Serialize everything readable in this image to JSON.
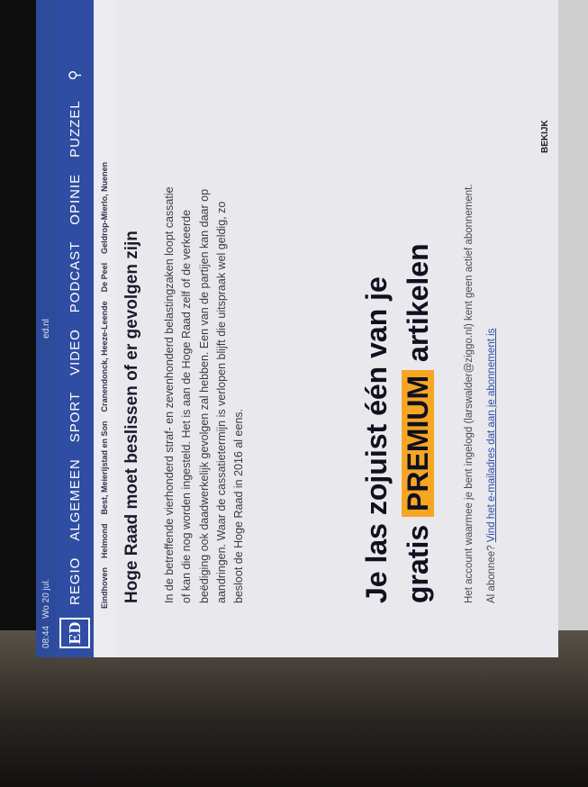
{
  "status": {
    "time": "08:44",
    "date": "Wo 20 jul.",
    "url": "ed.nl"
  },
  "nav": {
    "logo": "ED",
    "items": [
      "REGIO",
      "ALGEMEEN",
      "SPORT",
      "VIDEO",
      "PODCAST",
      "OPINIE",
      "PUZZEL"
    ],
    "search_icon": "search-icon"
  },
  "subnav": [
    "Eindhoven",
    "Helmond",
    "Best, Meierijstad en Son",
    "Cranendonck, Heeze-Leende",
    "De Peel",
    "Geldrop-Mierlo, Nuenen"
  ],
  "article": {
    "headline": "Hoge Raad moet beslissen of er gevolgen zijn",
    "body": "In de betreffende vierhonderd straf- en zevenhonderd belastingzaken loopt cassatie of kan die nog worden ingesteld. Het is aan de Hoge Raad zelf of de verkeerde beëdiging ook daadwerkelijk gevolgen zal hebben. Een van de partijen kan daar op aandringen. Waar de cassatietermijn is verlopen blijft die uitspraak wel geldig, zo besloot de Hoge Raad in 2016 al eens."
  },
  "paywall": {
    "line1": "Je las zojuist één van je",
    "line2_pre": "gratis",
    "badge": "PREMIUM",
    "line2_post": "artikelen",
    "account_info": "Het account waarmee je bent ingelogd (larswalder@ziggo.nl) kent geen actief abonnement.",
    "link_prefix": "Al abonnee?",
    "link_text": "Vind het e-mailadres dat aan je abonnement is"
  },
  "sidebar": {
    "more_label": "BEKIJK"
  },
  "colors": {
    "nav": "#2f4ea3",
    "premium": "#f6a623"
  }
}
